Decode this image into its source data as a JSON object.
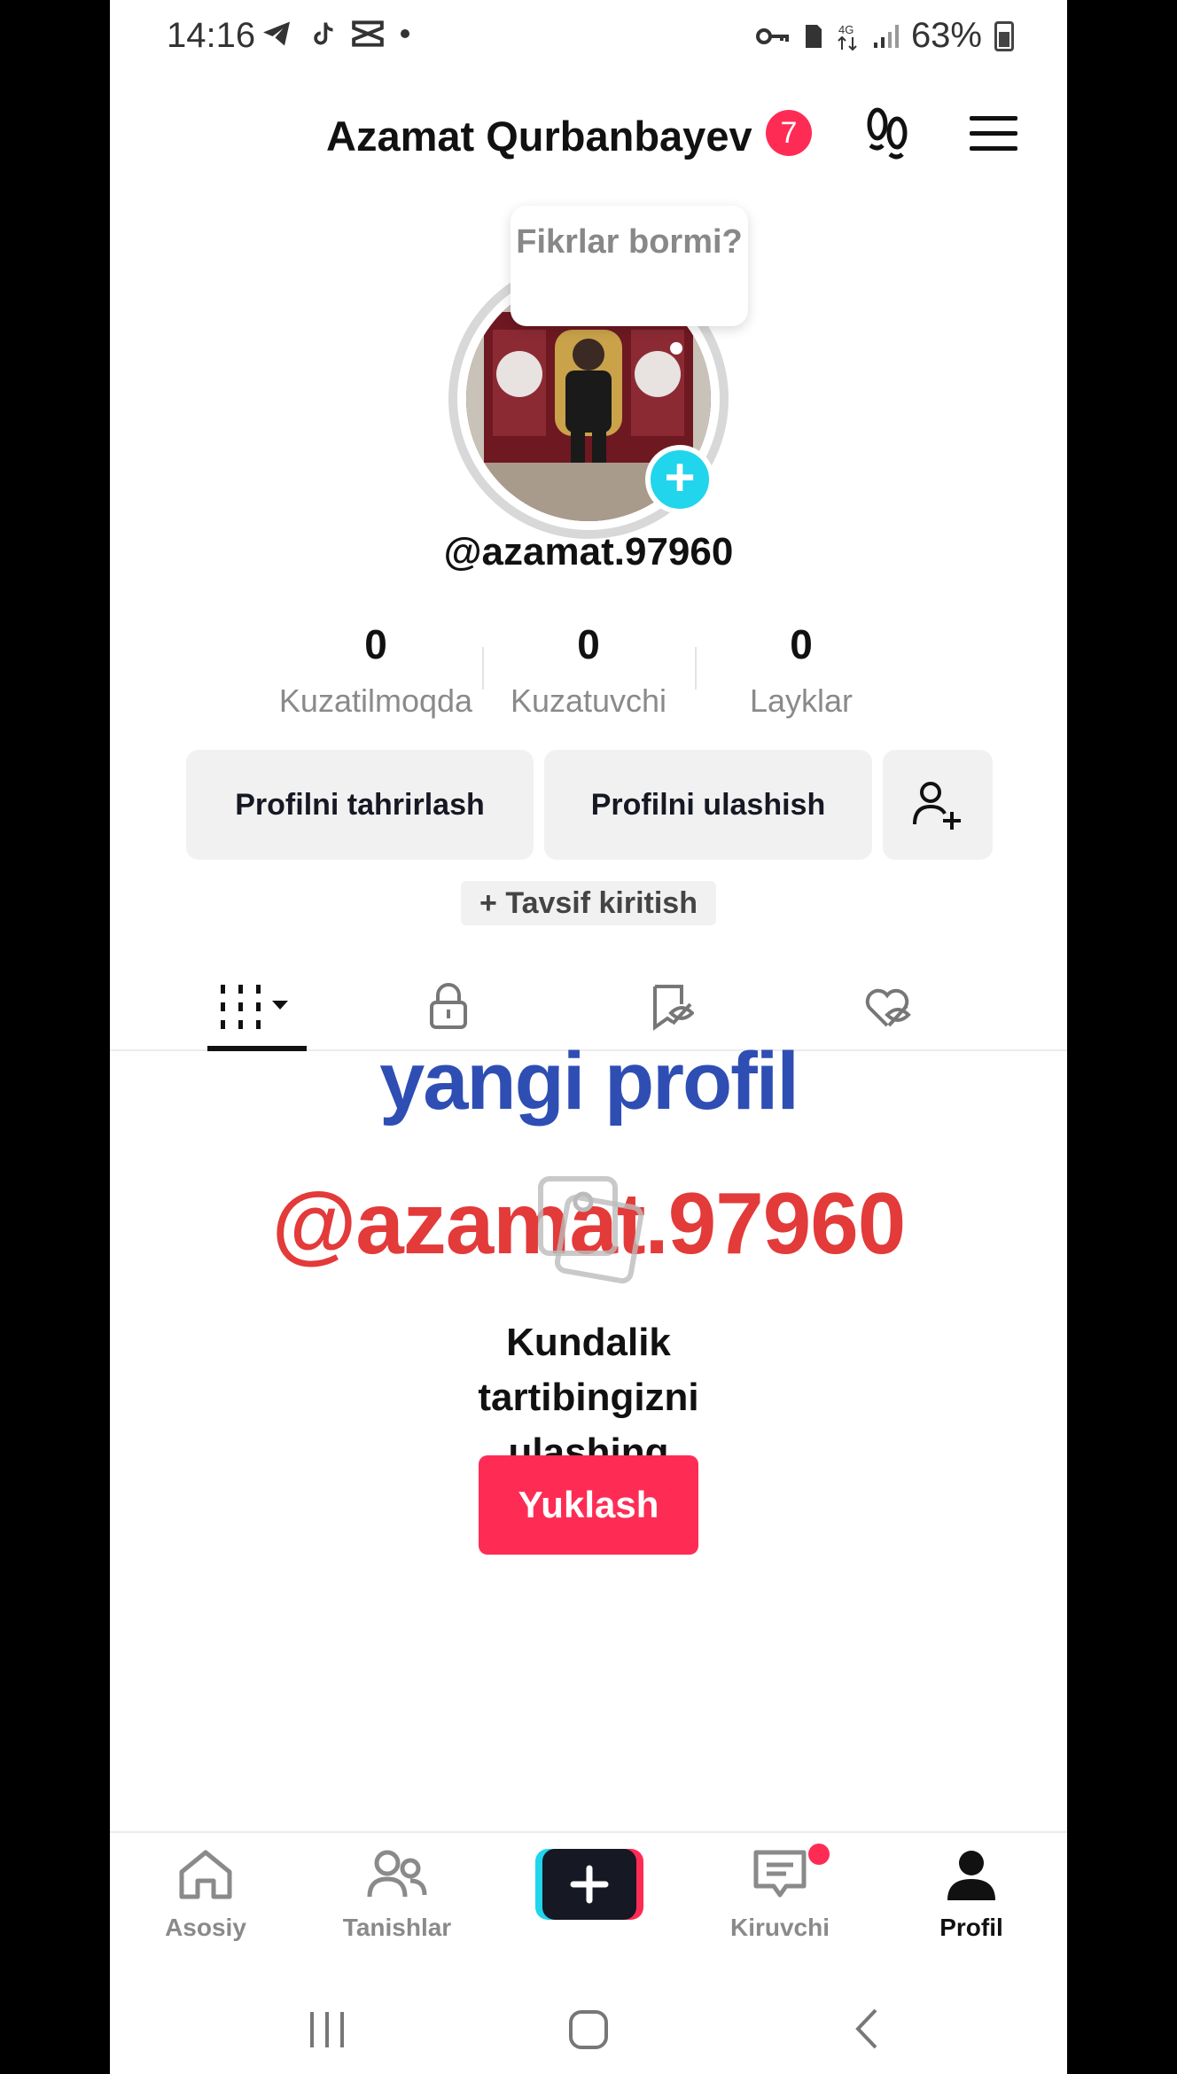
{
  "status_bar": {
    "time": "14:16",
    "battery": "63%",
    "network": "4G"
  },
  "header": {
    "name": "Azamat Qurbanbayev",
    "notification_count": "7"
  },
  "profile": {
    "bubble_text": "Fikrlar bormi?",
    "username": "@azamat.97960",
    "stats": [
      {
        "value": "0",
        "label": "Kuzatilmoqda"
      },
      {
        "value": "0",
        "label": "Kuzatuvchi"
      },
      {
        "value": "0",
        "label": "Layklar"
      }
    ],
    "edit_button": "Profilni tahrirlash",
    "share_button": "Profilni ulashish",
    "bio_button": "+ Tavsif kiritish"
  },
  "content": {
    "watermark_line1": "yangi profil",
    "watermark_line2": "@azamat.97960",
    "empty_title": "Kundalik tartibingizni ulashing",
    "upload_button": "Yuklash"
  },
  "bottom_nav": {
    "items": [
      {
        "label": "Asosiy"
      },
      {
        "label": "Tanishlar"
      },
      {
        "label": "Kiruvchi"
      },
      {
        "label": "Profil"
      }
    ]
  },
  "colors": {
    "accent": "#fe2c55",
    "avatar_plus": "#20d5ec",
    "watermark_blue": "#2f4eb4",
    "watermark_red": "#e33a3a"
  }
}
